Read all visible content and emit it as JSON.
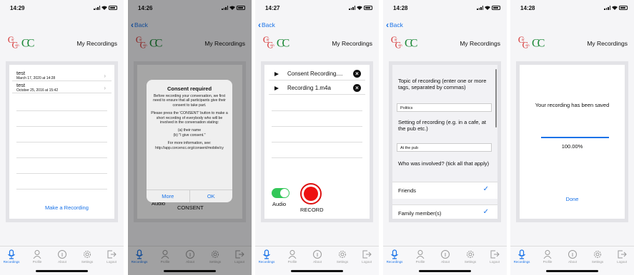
{
  "status": {
    "times": [
      "14:29",
      "14:26",
      "14:27",
      "14:28",
      "14:28"
    ]
  },
  "nav": {
    "back": "Back"
  },
  "header": {
    "title": "My Recordings"
  },
  "tabs": [
    "Recordings",
    "Profile",
    "About",
    "Settings",
    "Logout"
  ],
  "screen1": {
    "recordings": [
      {
        "title": "test",
        "date": "March 17, 2020 at 14:28"
      },
      {
        "title": "test",
        "date": "October 25, 2016 at 15:42"
      }
    ],
    "make_recording": "Make a Recording"
  },
  "screen2": {
    "dialog": {
      "title": "Consent required",
      "p1": "Before recording your conversation, we first need to ensure that all participants give their consent to take part.",
      "p2": "Please press the 'CONSENT' button to make a short recording of everybody who will be involved in the conversation stating:",
      "p3a": "(a) their name",
      "p3b": "(b) \"I give consent.\"",
      "p4": "For more information, see: http://app.corcencc.org/consent/mobile/cy",
      "more": "More",
      "ok": "OK"
    },
    "audio": "Audio",
    "consent": "CONSENT"
  },
  "screen3": {
    "files": [
      "Consent Recording....",
      "Recording 1.m4a"
    ],
    "audio": "Audio",
    "record": "RECORD"
  },
  "screen4": {
    "topic_label": "Topic of recording (enter one or more tags, separated by commas)",
    "topic_value": "Politics",
    "setting_label": "Setting of recording (e.g. in a cafe, at the pub etc.)",
    "setting_value": "At the pub",
    "involved_label": "Who was involved? (tick all that apply)",
    "options": [
      "Friends",
      "Family member(s)"
    ]
  },
  "screen5": {
    "saved": "Your recording has been saved",
    "percent": "100.00%",
    "progress": 1.0,
    "done": "Done"
  },
  "colors": {
    "accent": "#1a73e8",
    "record": "#e11111",
    "toggle": "#34c759",
    "logo_red": "#d42b2b",
    "logo_green": "#1f8a3a"
  }
}
